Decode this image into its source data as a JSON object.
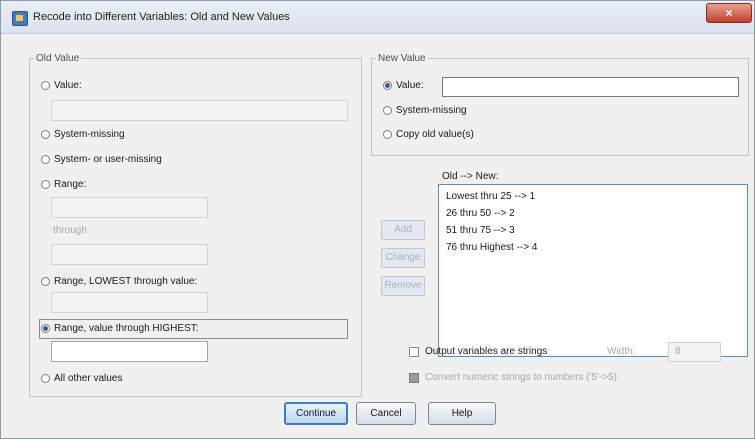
{
  "window": {
    "title": "Recode into Different Variables: Old and New Values",
    "close_label": "×"
  },
  "old_value": {
    "legend": "Old Value",
    "value_label": "Value:",
    "system_missing_label": "System-missing",
    "system_or_user_missing_label": "System- or user-missing",
    "range_label": "Range:",
    "through_label": "through",
    "range_lowest_label": "Range, LOWEST through value:",
    "range_highest_label": "Range, value through HIGHEST:",
    "range_highest_value": "",
    "all_other_label": "All other values",
    "selected": "range_highest"
  },
  "new_value": {
    "legend": "New Value",
    "value_label": "Value:",
    "value_input": "",
    "system_missing_label": "System-missing",
    "copy_old_label": "Copy old value(s)",
    "selected": "value"
  },
  "mapping": {
    "list_label": "Old --> New:",
    "items": [
      "Lowest thru 25 --> 1",
      "26 thru 50 --> 2",
      "51 thru 75 --> 3",
      "76 thru Highest --> 4"
    ],
    "add_label": "Add",
    "change_label": "Change",
    "remove_label": "Remove"
  },
  "options": {
    "output_strings_label": "Output variables are strings",
    "output_strings_checked": false,
    "width_label": "Width:",
    "width_value": "8",
    "convert_label": "Convert numeric strings to numbers ('5'->5)",
    "convert_checked": false
  },
  "buttons": {
    "continue_label": "Continue",
    "cancel_label": "Cancel",
    "help_label": "Help"
  },
  "colors": {
    "accent": "#3c7fc4",
    "selected_radio": "#2e5aa8",
    "disabled_text": "#a8a8a8"
  }
}
